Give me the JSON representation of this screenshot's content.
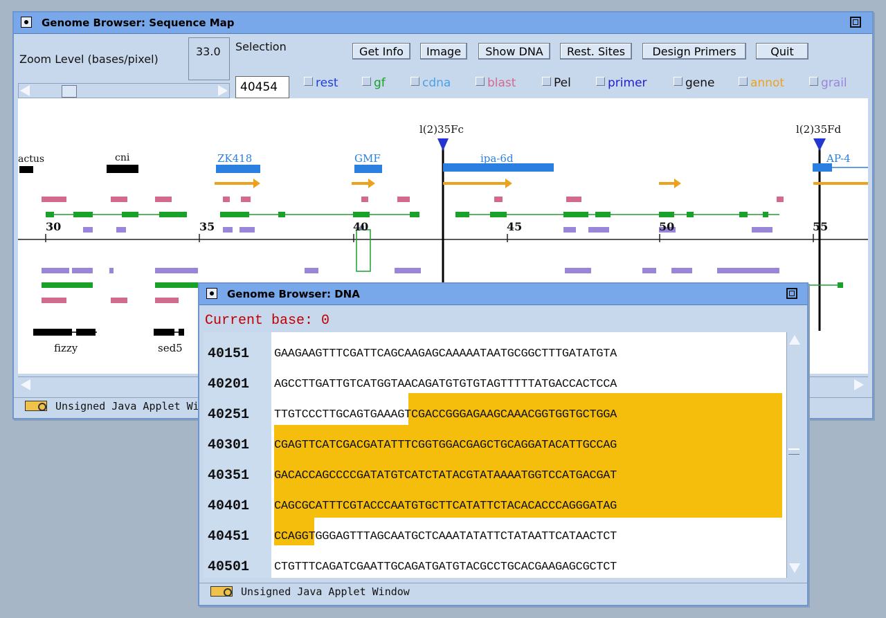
{
  "seqmap_window": {
    "title": "Genome Browser: Sequence Map",
    "zoom_label": "Zoom Level (bases/pixel)",
    "zoom_value": "33.0",
    "selection_label": "Selection",
    "selection_value": "40454",
    "buttons": [
      "Get Info",
      "Image",
      "Show DNA",
      "Rest. Sites",
      "Design Primers",
      "Quit"
    ],
    "tracks": [
      {
        "label": "rest",
        "color": "#1c3fe0"
      },
      {
        "label": "gf",
        "color": "#1aa12a"
      },
      {
        "label": "cdna",
        "color": "#4aa0e6"
      },
      {
        "label": "blast",
        "color": "#d26a8e"
      },
      {
        "label": "Pel",
        "color": "#111111"
      },
      {
        "label": "primer",
        "color": "#2020d0"
      },
      {
        "label": "gene",
        "color": "#111111"
      },
      {
        "label": "annot",
        "color": "#eba21e"
      },
      {
        "label": "grail",
        "color": "#9a86d8"
      }
    ],
    "status": "Unsigned Java Applet Wi",
    "map": {
      "markers": [
        "l(2)35Fc",
        "l(2)35Fd"
      ],
      "genes_top": [
        "actus",
        "cni",
        "ZK418",
        "GMF",
        "ipa-6d",
        "AP-4"
      ],
      "genes_bottom": [
        "fizzy",
        "sed5"
      ],
      "axis_ticks": [
        "30",
        "35",
        "40",
        "45",
        "50",
        "55"
      ]
    }
  },
  "dna_window": {
    "title": "Genome Browser: DNA",
    "current_base": "Current base: 0",
    "status": "Unsigned Java Applet Window",
    "rows": [
      {
        "pos": "40151",
        "seq": "GAAGAAGTTTCGATTCAGCAAGAGCAAAAATAATGCGGCTTTGATATGTA"
      },
      {
        "pos": "40201",
        "seq": "AGCCTTGATTGTCATGGTAACAGATGTGTGTAGTTTTTATGACCACTCCA"
      },
      {
        "pos": "40251",
        "seq": "TTGTCCCTTGCAGTGAAAGTCGACCGGGAGAAGCAAACGGTGGTGCTGGA"
      },
      {
        "pos": "40301",
        "seq": "CGAGTTCATCGACGATATTTCGGTGGACGAGCTGCAGGATACATTGCCAG"
      },
      {
        "pos": "40351",
        "seq": "GACACCAGCCCCGATATGTCATCTATACGTATAAAATGGTCCATGACGAT"
      },
      {
        "pos": "40401",
        "seq": "CAGCGCATTTCGTACCCAATGTGCTTCATATTCTACACACCCAGGGATAG"
      },
      {
        "pos": "40451",
        "seq": "CCAGGTGGGAGTTTAGCAATGCTCAAATATATTCTATAATTCATAACTCT"
      },
      {
        "pos": "40501",
        "seq": "CTGTTTCAGATCGAATTGCAGATGATGTACGCCTGCACGAAGAGCGCTCT"
      }
    ]
  },
  "colors": {
    "highlight": "#f6be0c",
    "window_bg": "#c8d8ec",
    "titlebar": "#78a8ea",
    "current_base": "#c00000"
  }
}
